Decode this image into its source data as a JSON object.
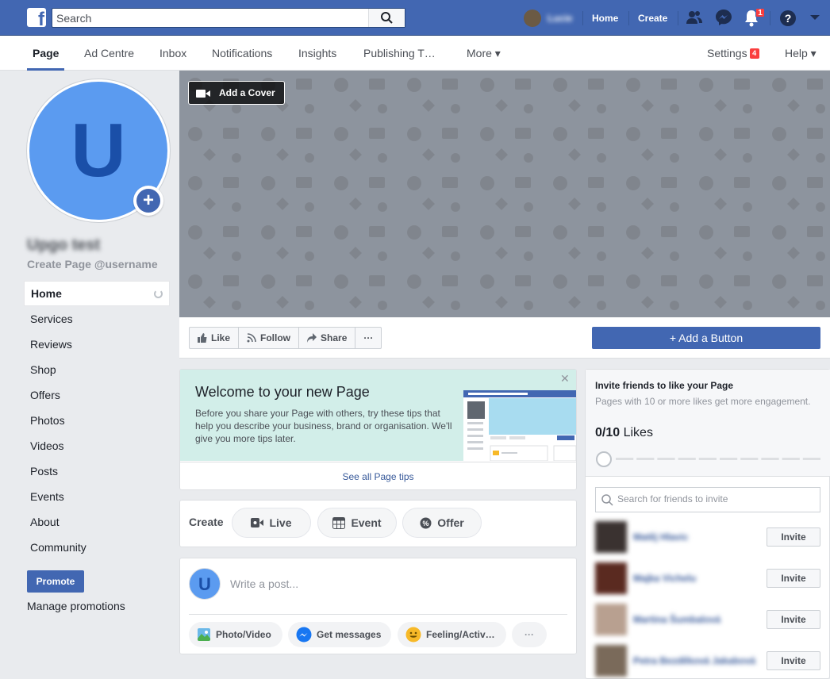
{
  "topbar": {
    "logo": "f",
    "search_placeholder": "Search",
    "user_name": "Lucie",
    "nav": [
      "Home",
      "Create"
    ],
    "notifications_count": "1"
  },
  "page_tabs": {
    "items": [
      "Page",
      "Ad Centre",
      "Inbox",
      "Notifications",
      "Insights",
      "Publishing T…",
      "More ▾"
    ],
    "settings": "Settings",
    "settings_badge": "4",
    "help": "Help ▾"
  },
  "profile": {
    "initial": "U",
    "name": "Upgo test",
    "username_link": "Create Page @username"
  },
  "sidebar": {
    "items": [
      "Home",
      "Services",
      "Reviews",
      "Shop",
      "Offers",
      "Photos",
      "Videos",
      "Posts",
      "Events",
      "About",
      "Community"
    ],
    "promote": "Promote",
    "manage_promotions": "Manage promotions"
  },
  "cover": {
    "add_cover": "Add a Cover"
  },
  "actions": {
    "like": "Like",
    "follow": "Follow",
    "share": "Share",
    "more": "···",
    "add_button": "+ Add a Button"
  },
  "welcome": {
    "title": "Welcome to your new Page",
    "text": "Before you share your Page with others, try these tips that help you describe your business, brand or organisation. We'll give you more tips later.",
    "close": "✕",
    "see_all": "See all Page tips"
  },
  "create": {
    "label": "Create",
    "live": "Live",
    "event": "Event",
    "offer": "Offer"
  },
  "post": {
    "initial": "U",
    "placeholder": "Write a post...",
    "photo_video": "Photo/Video",
    "get_messages": "Get messages",
    "feeling": "Feeling/Activ…",
    "more": "···"
  },
  "invite": {
    "title": "Invite friends to like your Page",
    "subtitle": "Pages with 10 or more likes get more engagement.",
    "likes_count": "0/10",
    "likes_label": "Likes",
    "progress": 0,
    "search_placeholder": "Search for friends to invite",
    "invite_label": "Invite",
    "friends": [
      {
        "name": "Matěj Hlavic"
      },
      {
        "name": "Majka Vichelu"
      },
      {
        "name": "Martina Šumbalová"
      },
      {
        "name": "Petra Bezděková Jakabová"
      }
    ]
  },
  "colors": {
    "brand": "#4267b2",
    "cover": "#8d949e",
    "welcome_bg": "#d2eee9",
    "badge": "#fa3e3e"
  }
}
